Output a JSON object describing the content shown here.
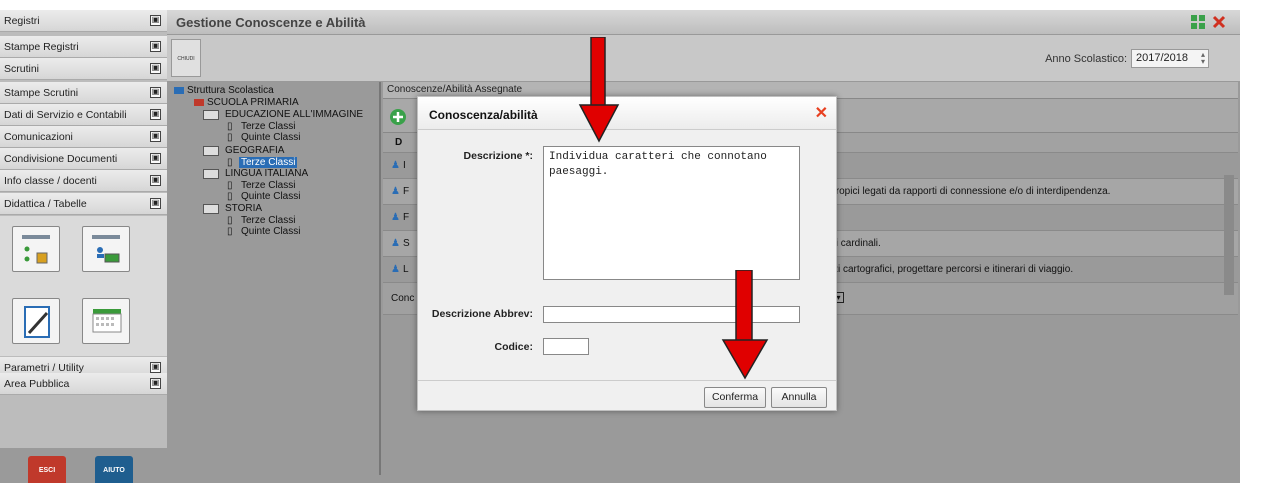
{
  "sidebar": {
    "items": [
      {
        "label": "Registri",
        "toggle": "▣"
      },
      {
        "label": "Stampe Registri",
        "toggle": "▣"
      },
      {
        "label": "Scrutini",
        "toggle": "▣"
      },
      {
        "label": "Stampe Scrutini",
        "toggle": "▣"
      },
      {
        "label": "Dati di Servizio e Contabili",
        "toggle": "▣"
      },
      {
        "label": "Comunicazioni",
        "toggle": "▣"
      },
      {
        "label": "Condivisione Documenti",
        "toggle": "▣"
      },
      {
        "label": "Info classe / docenti",
        "toggle": "▣"
      },
      {
        "label": "Didattica / Tabelle",
        "toggle": "▣"
      },
      {
        "label": "Parametri / Utility",
        "toggle": "▣"
      },
      {
        "label": "Area Pubblica",
        "toggle": "▣"
      }
    ],
    "bottom_buttons": {
      "esci": "ESCI",
      "aiuto": "AIUTO"
    }
  },
  "window": {
    "title": "Gestione Conoscenze e Abilità"
  },
  "toolbar": {
    "chiudi_label": "CHIUDI",
    "anno_label": "Anno Scolastico:",
    "anno_value": "2017/2018"
  },
  "tree": {
    "root": "Struttura Scolastica",
    "school": "SCUOLA PRIMARIA",
    "subjects": [
      {
        "name": "EDUCAZIONE ALL'IMMAGINE",
        "classes": [
          "Terze Classi",
          "Quinte Classi"
        ]
      },
      {
        "name": "GEOGRAFIA",
        "classes": [
          "Terze Classi"
        ]
      },
      {
        "name": "LINGUA ITALIANA",
        "classes": [
          "Terze Classi",
          "Quinte Classi"
        ]
      },
      {
        "name": "STORIA",
        "classes": [
          "Terze Classi",
          "Quinte Classi"
        ]
      }
    ]
  },
  "grid": {
    "header": "Conoscenze/Abilità Assegnate",
    "col_initial": "D",
    "rows": [
      {
        "initial": "I",
        "tail": ""
      },
      {
        "initial": "F",
        "tail": "tropici legati da rapporti di connessione e/o di interdipendenza."
      },
      {
        "initial": "F",
        "tail": ""
      },
      {
        "initial": "S",
        "tail": "ti cardinali."
      },
      {
        "initial": "L",
        "tail": "zi cartografici, progettare percorsi e itinerari di viaggio."
      }
    ],
    "footer_initial": "Conc"
  },
  "modal": {
    "title": "Conoscenza/abilità",
    "close": "✕",
    "descrizione_label": "Descrizione *:",
    "descrizione_value": "Individua caratteri che connotano\npaesaggi.",
    "abbrev_label": "Descrizione Abbrev:",
    "abbrev_value": "",
    "codice_label": "Codice:",
    "codice_value": "",
    "confirm_label": "Conferma",
    "cancel_label": "Annulla"
  },
  "colors": {
    "arrow": "#e00000",
    "close": "#e84020",
    "add": "#3aa14a",
    "selected": "#2a6db5"
  }
}
